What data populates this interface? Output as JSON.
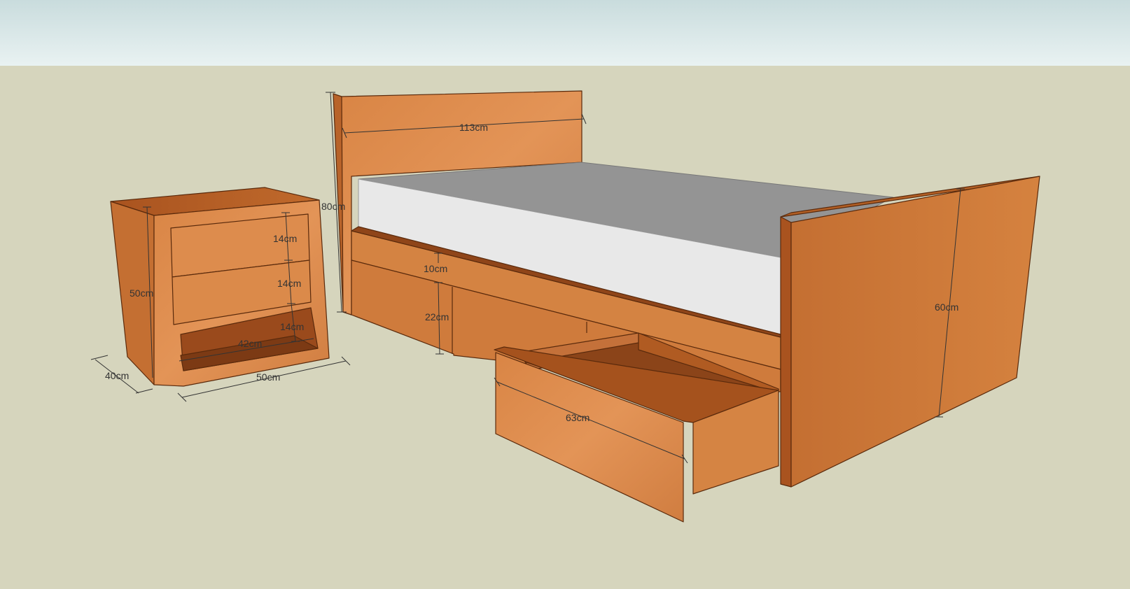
{
  "colors": {
    "sky_top": "#c9dcdd",
    "sky_bottom": "#e9f2f2",
    "ground": "#d6d5bd",
    "wood_light": "#e08f50",
    "wood_mid": "#cd7a3c",
    "wood_dark": "#8a4117",
    "mattress_top": "#949494",
    "mattress_side": "#e8e8e8",
    "dimension_ink": "#333333"
  },
  "nightstand": {
    "dims": {
      "drawer_top": "14cm",
      "drawer_middle": "14cm",
      "open_shelf": "14cm",
      "height": "50cm",
      "inner_width": "42cm",
      "depth": "40cm",
      "width": "50cm"
    }
  },
  "bed": {
    "dims": {
      "headboard_width": "113cm",
      "headboard_height": "80cm",
      "mattress_to_rail": "10cm",
      "base_height": "22cm",
      "drawer_length": "63cm",
      "footboard_height": "60cm"
    }
  }
}
